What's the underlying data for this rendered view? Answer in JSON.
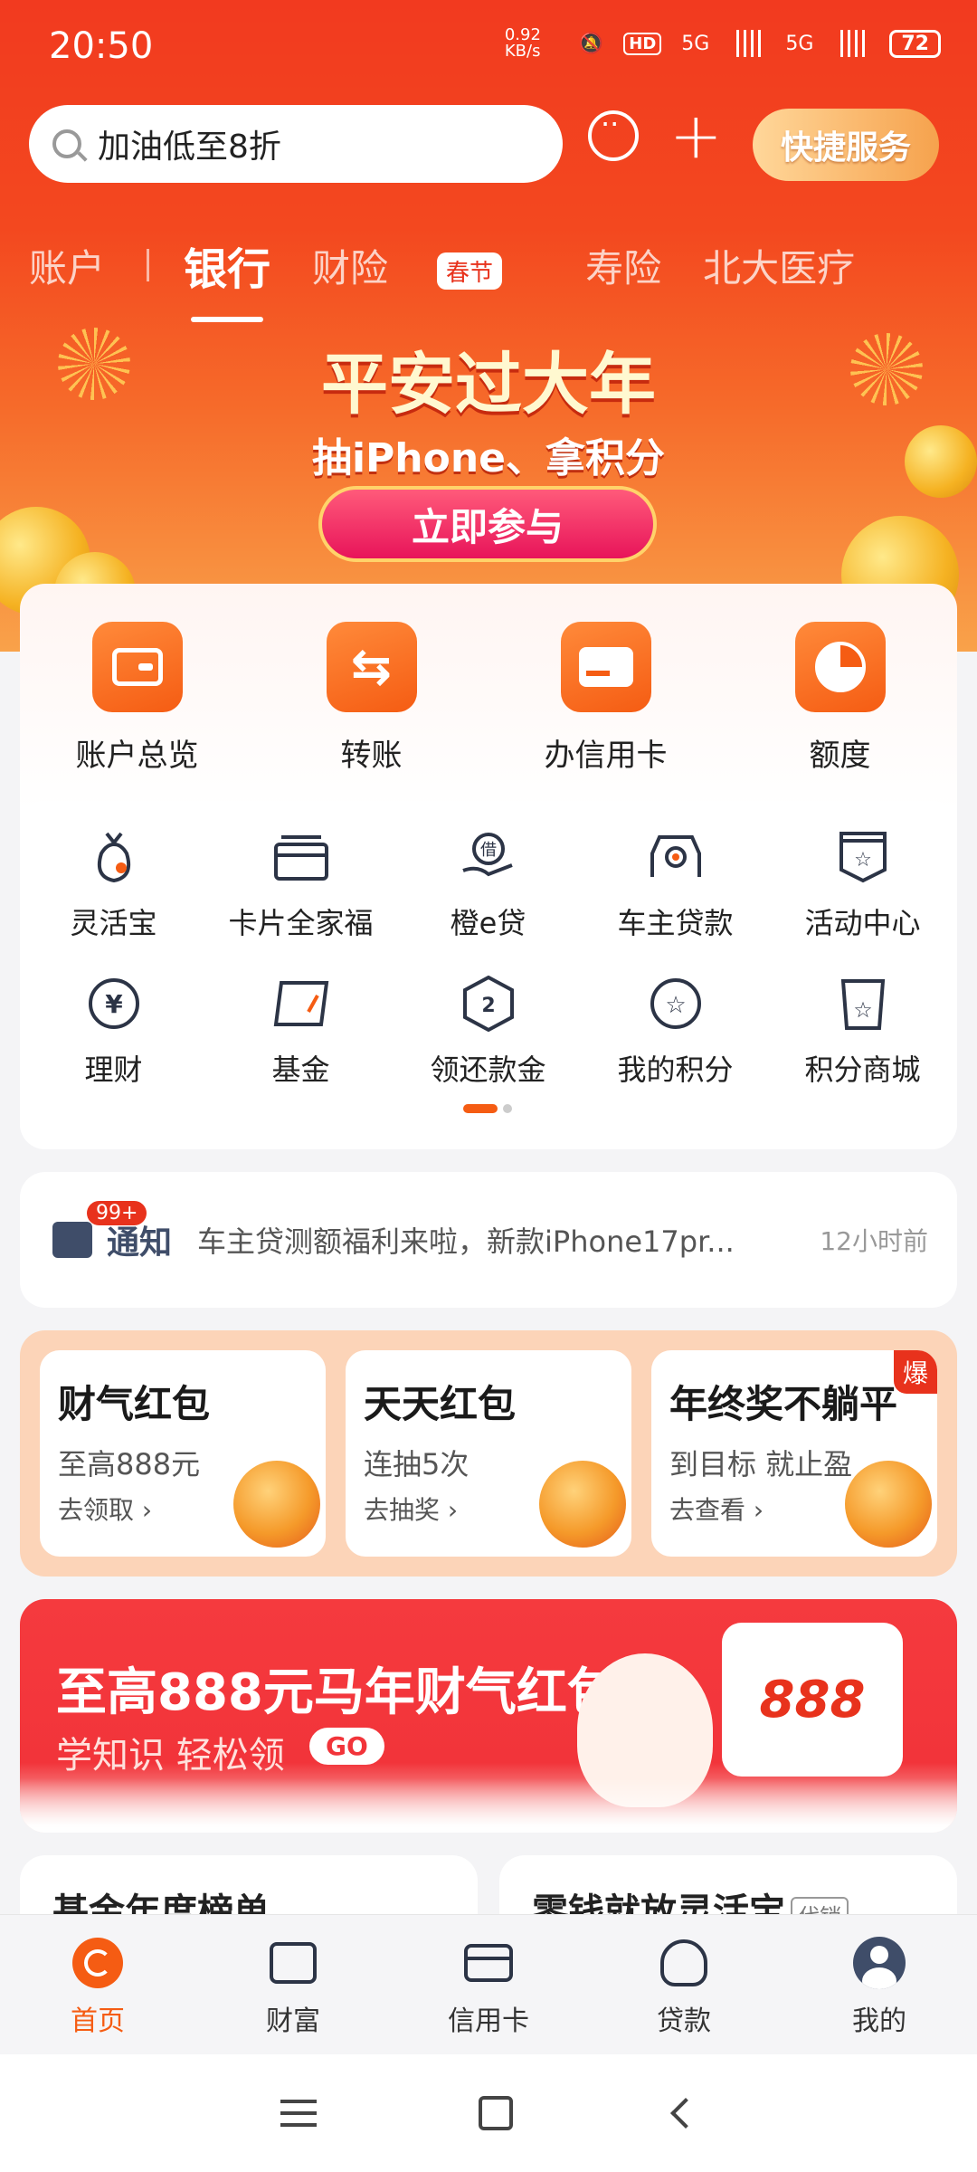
{
  "status_bar": {
    "time": "20:50",
    "net_speed": "0.92 KB/s",
    "hd": "HD",
    "net1": "5G",
    "net2": "5G",
    "battery": "72"
  },
  "header": {
    "search_placeholder": "加油低至8折",
    "quick_service": "快捷服务"
  },
  "tabs": [
    {
      "label": "账户"
    },
    {
      "label": "银行"
    },
    {
      "label": "财险",
      "badge": "春节"
    },
    {
      "label": "寿险"
    },
    {
      "label": "北大医疗"
    }
  ],
  "banner": {
    "title": "平安过大年",
    "subtitle": "抽iPhone、拿积分",
    "button": "立即参与"
  },
  "main_actions": [
    {
      "label": "账户总览",
      "icon": "wallet-icon"
    },
    {
      "label": "转账",
      "icon": "transfer-icon"
    },
    {
      "label": "办信用卡",
      "icon": "card-icon"
    },
    {
      "label": "额度",
      "icon": "pie-icon"
    }
  ],
  "service_rows": [
    [
      {
        "label": "灵活宝",
        "icon": "money-bag-icon"
      },
      {
        "label": "卡片全家福",
        "icon": "card-stack-icon"
      },
      {
        "label": "橙e贷",
        "icon": "loan-hand-icon"
      },
      {
        "label": "车主贷款",
        "icon": "car-icon"
      },
      {
        "label": "活动中心",
        "icon": "star-badge-icon"
      }
    ],
    [
      {
        "label": "理财",
        "icon": "yuan-icon"
      },
      {
        "label": "基金",
        "icon": "fund-icon"
      },
      {
        "label": "领还款金",
        "icon": "repay-icon"
      },
      {
        "label": "我的积分",
        "icon": "star-circle-icon"
      },
      {
        "label": "积分商城",
        "icon": "star-bag-icon"
      }
    ]
  ],
  "notice": {
    "count": "99+",
    "title": "通知",
    "message": "车主贷测额福利来啦，新款iPhone17pr...",
    "time": "12小时前"
  },
  "packets": [
    {
      "title": "财气红包",
      "sub": "至高888元",
      "link": "去领取 ›"
    },
    {
      "title": "天天红包",
      "sub": "连抽5次",
      "link": "去抽奖 ›"
    },
    {
      "title": "年终奖不躺平",
      "sub": "到目标 就止盈",
      "link": "去查看 ›",
      "badge": "爆"
    }
  ],
  "promo": {
    "headline": "至高888元马年财气红包",
    "sub": "学知识 轻松领",
    "go": "GO",
    "amount": "888"
  },
  "partial_cards": {
    "left": "基金年度榜单",
    "right": "零钱就放灵活宝",
    "right_tag": "代销"
  },
  "bottom_nav": [
    {
      "label": "首页",
      "active": true
    },
    {
      "label": "财富"
    },
    {
      "label": "信用卡"
    },
    {
      "label": "贷款"
    },
    {
      "label": "我的"
    }
  ],
  "colors": {
    "brand_orange": "#f55c13",
    "header_red": "#f23a1f"
  }
}
